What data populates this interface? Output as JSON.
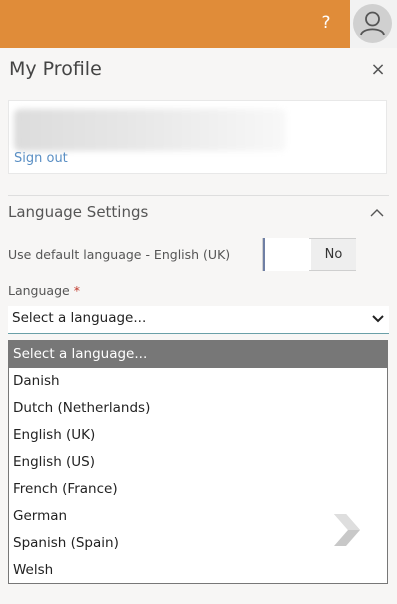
{
  "header": {
    "help_icon": "question-mark",
    "help_glyph": "?",
    "avatar_icon": "user-icon",
    "accent_color": "#e08c39"
  },
  "panel": {
    "title": "My Profile",
    "close_glyph": "×"
  },
  "profile": {
    "sign_out_label": "Sign out"
  },
  "language_settings": {
    "section_title": "Language Settings",
    "default_label": "Use default language - English (UK)",
    "toggle_value": "No",
    "language_label": "Language",
    "required_mark": "*",
    "selected_value": "Select a language...",
    "options": [
      "Select a language...",
      "Danish",
      "Dutch (Netherlands)",
      "English (UK)",
      "English (US)",
      "French (France)",
      "German",
      "Spanish (Spain)",
      "Welsh"
    ]
  }
}
